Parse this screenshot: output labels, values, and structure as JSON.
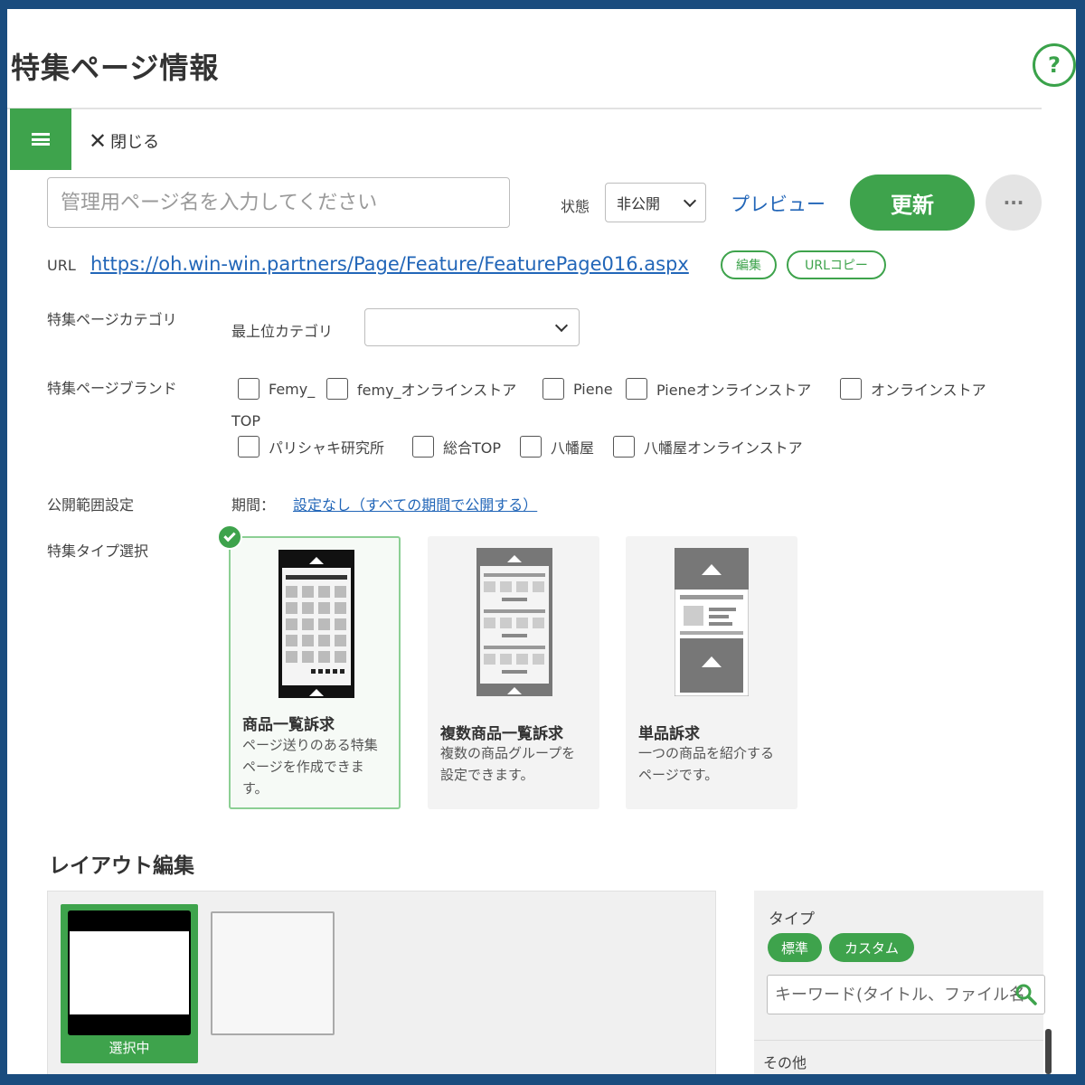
{
  "header": {
    "title": "特集ページ情報",
    "help_label": "?",
    "close_label": "閉じる",
    "close_icon_glyph": "✕"
  },
  "toolbar": {
    "name_placeholder": "管理用ページ名を入力してください",
    "name_value": "",
    "status_label": "状態",
    "status_value": "非公開",
    "preview_label": "プレビュー",
    "update_label": "更新",
    "more_label": "···"
  },
  "url": {
    "label": "URL",
    "value": "https://oh.win-win.partners/Page/Feature/FeaturePage016.aspx",
    "edit_label": "編集",
    "copy_label": "URLコピー"
  },
  "category": {
    "label": "特集ページカテゴリ",
    "sub_label": "最上位カテゴリ",
    "selected": ""
  },
  "brand": {
    "label": "特集ページブランド",
    "row1": [
      "Femy_",
      "femy_オンラインストア",
      "Piene",
      "Pieneオンラインストア",
      "オンラインストア"
    ],
    "wrap_text": "TOP",
    "row2": [
      "パリシャキ研究所",
      "総合TOP",
      "八幡屋",
      "八幡屋オンラインストア"
    ]
  },
  "publish": {
    "label": "公開範囲設定",
    "period_label": "期間：",
    "period_value": "設定なし（すべての期間で公開する）"
  },
  "feature_type": {
    "label": "特集タイプ選択",
    "cards": [
      {
        "title": "商品一覧訴求",
        "desc_lines": [
          "ページ送りのある特集",
          "ページを作成できま",
          "す。"
        ],
        "selected": true
      },
      {
        "title": "複数商品一覧訴求",
        "desc_lines": [
          "複数の商品グループを",
          "設定できます。"
        ],
        "selected": false
      },
      {
        "title": "単品訴求",
        "desc_lines": [
          "一つの商品を紹介する",
          "ページです。"
        ],
        "selected": false
      }
    ]
  },
  "layout": {
    "title": "レイアウト編集",
    "selected_label": "選択中"
  },
  "side": {
    "type_label": "タイプ",
    "filters": [
      "標準",
      "カスタム"
    ],
    "keyword_placeholder": "キーワード(タイトル、ファイル名",
    "other_label": "その他"
  },
  "colors": {
    "accent": "#3ea34c",
    "link": "#2266b8",
    "frame": "#1a4c7e"
  }
}
